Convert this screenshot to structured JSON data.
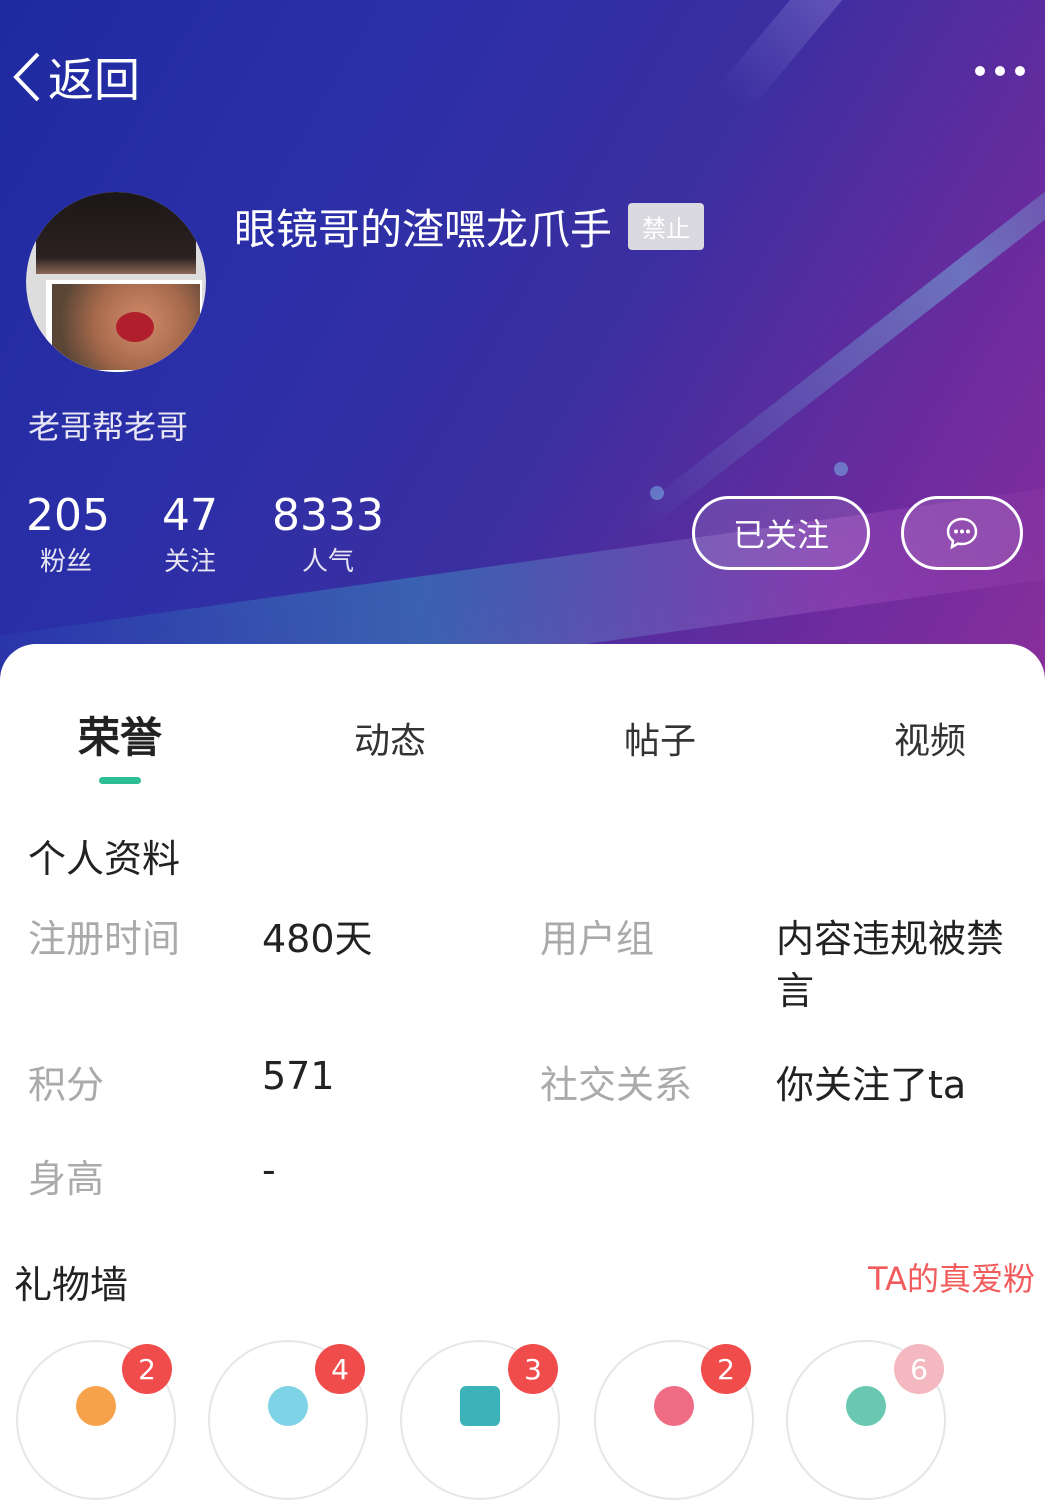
{
  "header": {
    "back_label": "返回"
  },
  "profile": {
    "username": "眼镜哥的渣嘿龙爪手",
    "badge": "禁止",
    "signature": "老哥帮老哥"
  },
  "stats": [
    {
      "value": "205",
      "label": "粉丝"
    },
    {
      "value": "47",
      "label": "关注"
    },
    {
      "value": "8333",
      "label": "人气"
    }
  ],
  "actions": {
    "follow_label": "已关注"
  },
  "tabs": [
    {
      "label": "荣誉",
      "active": true
    },
    {
      "label": "动态"
    },
    {
      "label": "帖子"
    },
    {
      "label": "视频"
    }
  ],
  "info": {
    "title": "个人资料",
    "reg_time_label": "注册时间",
    "reg_time_value": "480天",
    "user_group_label": "用户组",
    "user_group_value_line1": "内容违规被禁",
    "user_group_value_line2": "言",
    "points_label": "积分",
    "points_value": "571",
    "social_label": "社交关系",
    "social_value": "你关注了ta",
    "height_label": "身高",
    "height_value": "-"
  },
  "gifts": {
    "title": "礼物墙",
    "link": "TA的真爱粉",
    "items": [
      {
        "count": "2"
      },
      {
        "count": "4"
      },
      {
        "count": "3"
      },
      {
        "count": "2"
      },
      {
        "count": "6"
      }
    ]
  },
  "colors": {
    "accent": "#2cbf96",
    "badge_red": "#f04c4c",
    "link_red": "#f25b5b"
  }
}
